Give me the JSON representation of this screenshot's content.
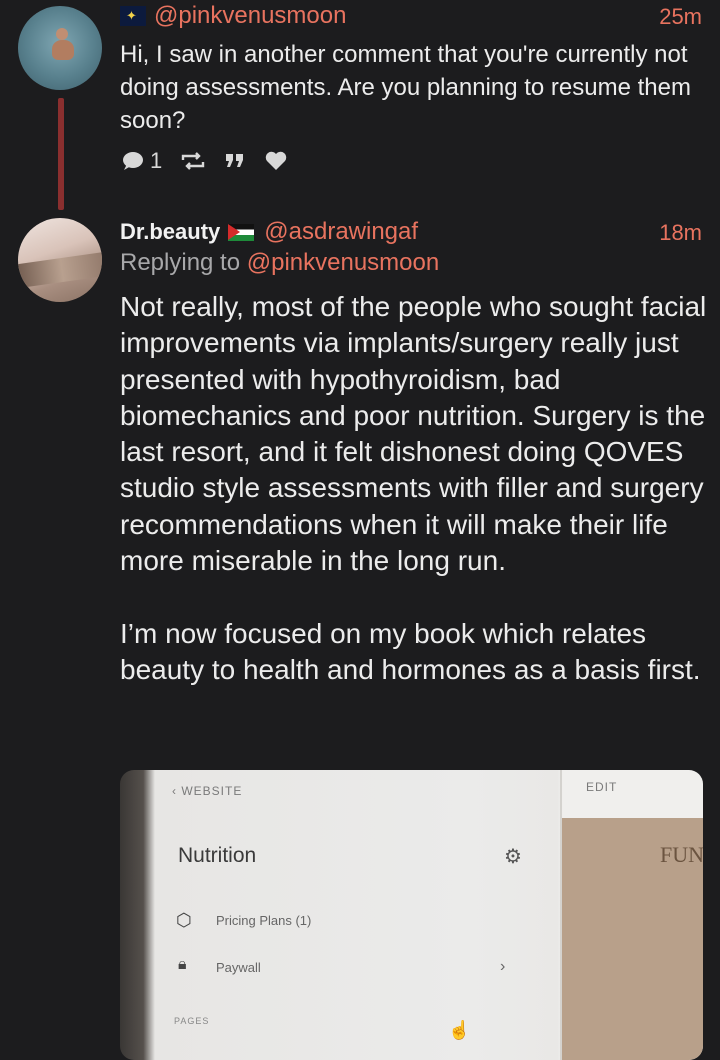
{
  "post1": {
    "handle": "@pinkvenusmoon",
    "time": "25m",
    "text": "Hi, I saw in another comment that you're currently not doing assessments. Are you planning to resume them soon?",
    "reply_count": "1"
  },
  "post2": {
    "display_name": "Dr.beauty",
    "handle": "@asdrawingaf",
    "time": "18m",
    "replying_prefix": "Replying to",
    "replying_handle": "@pinkvenusmoon",
    "text": "Not really, most of the people who sought facial improvements via implants/surgery really just presented with hypothyroidism, bad biomechanics and poor nutrition. Surgery is the last resort, and it felt dishonest doing QOVES studio style assessments with filler and surgery recommendations when it will make their life more miserable in the long run.\n\nI’m now focused on my book which relates beauty to health and hormones as a basis first."
  },
  "media": {
    "back_label": "WEBSITE",
    "edit_label": "EDIT",
    "title": "Nutrition",
    "right_text": "FUN",
    "item1": "Pricing Plans (1)",
    "item2": "Paywall",
    "section": "PAGES"
  },
  "icons": {
    "reply": "speech-bubble-icon",
    "repost": "repost-icon",
    "quote": "quote-icon",
    "like": "heart-icon"
  },
  "colors": {
    "background": "#1c1c1e",
    "accent": "#e8735f",
    "thread_line": "#8a2f2f"
  }
}
